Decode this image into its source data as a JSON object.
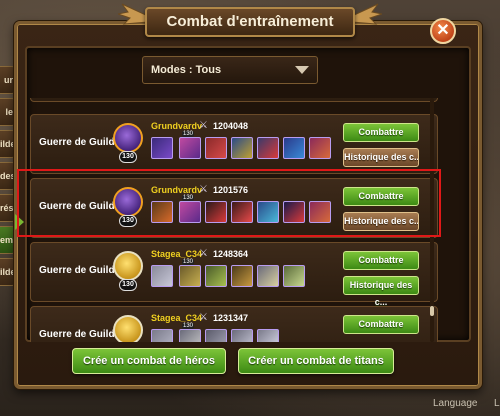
{
  "window": {
    "title": "Combat d'entraînement"
  },
  "side_tabs": [
    "ur",
    "le",
    "ilde",
    "des",
    "rés",
    "ement",
    "ilde"
  ],
  "filter": {
    "label": "Modes : Tous"
  },
  "rows": [
    {
      "mode": "Guerre de Guildes",
      "player": "Grundvardv",
      "power": "1204048",
      "level": "130",
      "emblem": "purple",
      "hero_level": "130",
      "primary": "Combattre",
      "secondary": "Historique des c..."
    },
    {
      "mode": "Guerre de Guildes",
      "player": "Grundvardv",
      "power": "1201576",
      "level": "130",
      "emblem": "purple",
      "hero_level": "130",
      "primary": "Combattre",
      "secondary": "Historique des c..."
    },
    {
      "mode": "Guerre de Guildes",
      "player": "Stagea_C34",
      "power": "1248364",
      "level": "130",
      "emblem": "gold",
      "hero_level": "130",
      "primary": "Combattre",
      "secondary": "Historique des c..."
    },
    {
      "mode": "Guerre de Guildes",
      "player": "Stagea_C34",
      "power": "1231347",
      "level": "130",
      "emblem": "gold",
      "hero_level": "130",
      "primary": "Combattre",
      "secondary": ""
    }
  ],
  "footer": {
    "create_hero": "Crée un combat de héros",
    "create_titan": "Créer un combat de titans"
  },
  "bottom": {
    "language": "Language",
    "edge": "L"
  },
  "colors": {
    "accent_green": "#5aa820",
    "highlight_red": "#e01818",
    "player_name": "#f0d020"
  },
  "icons": [
    "close-icon",
    "chevron-down-icon",
    "crossed-swords-icon",
    "guild-emblem-icon",
    "hero-portrait-icon"
  ]
}
